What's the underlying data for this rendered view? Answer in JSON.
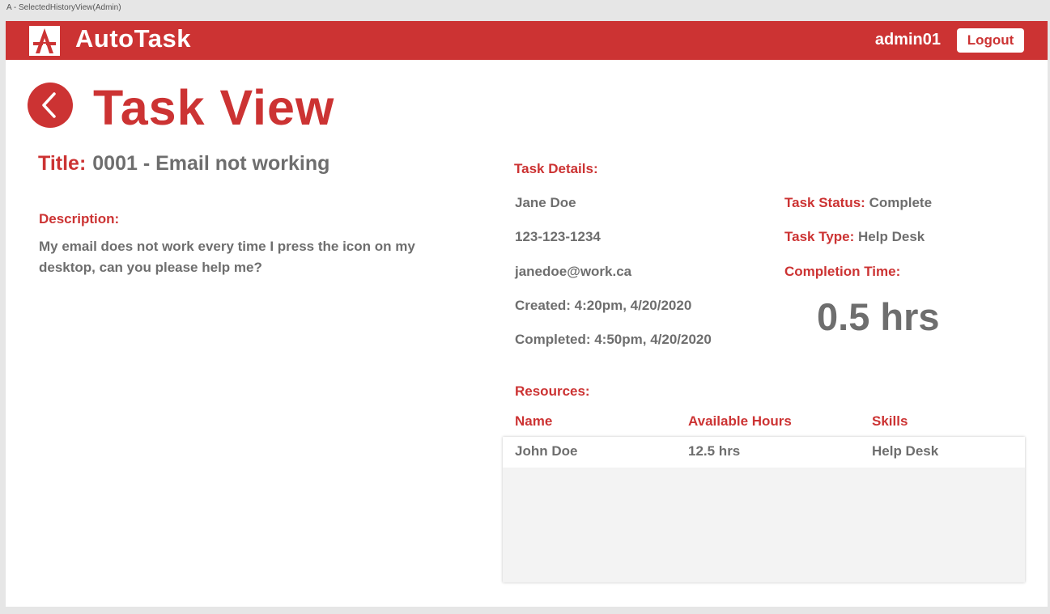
{
  "window": {
    "caption": "A - SelectedHistoryView(Admin)"
  },
  "header": {
    "brand": "AutoTask",
    "logo_icon": "autotask-logo-icon",
    "username": "admin01",
    "logout_label": "Logout",
    "accent_color": "#cc3333"
  },
  "page": {
    "title": "Task View",
    "back_icon": "chevron-left-icon"
  },
  "task": {
    "title_label": "Title:",
    "title_value": "0001 - Email not working",
    "description_label": "Description:",
    "description_text": "My email does not work every time I press the icon on my desktop, can you please help me?"
  },
  "details": {
    "label": "Task Details:",
    "name": "Jane Doe",
    "phone": "123-123-1234",
    "email": "janedoe@work.ca",
    "created": "Created: 4:20pm, 4/20/2020",
    "completed": "Completed: 4:50pm, 4/20/2020",
    "status_label": "Task Status:",
    "status_value": "Complete",
    "type_label": "Task Type:",
    "type_value": "Help Desk",
    "completion_label": "Completion Time:",
    "completion_value": "0.5 hrs"
  },
  "resources": {
    "label": "Resources:",
    "columns": [
      "Name",
      "Available Hours",
      "Skills"
    ],
    "rows": [
      [
        "John Doe",
        "12.5 hrs",
        "Help Desk"
      ]
    ]
  }
}
